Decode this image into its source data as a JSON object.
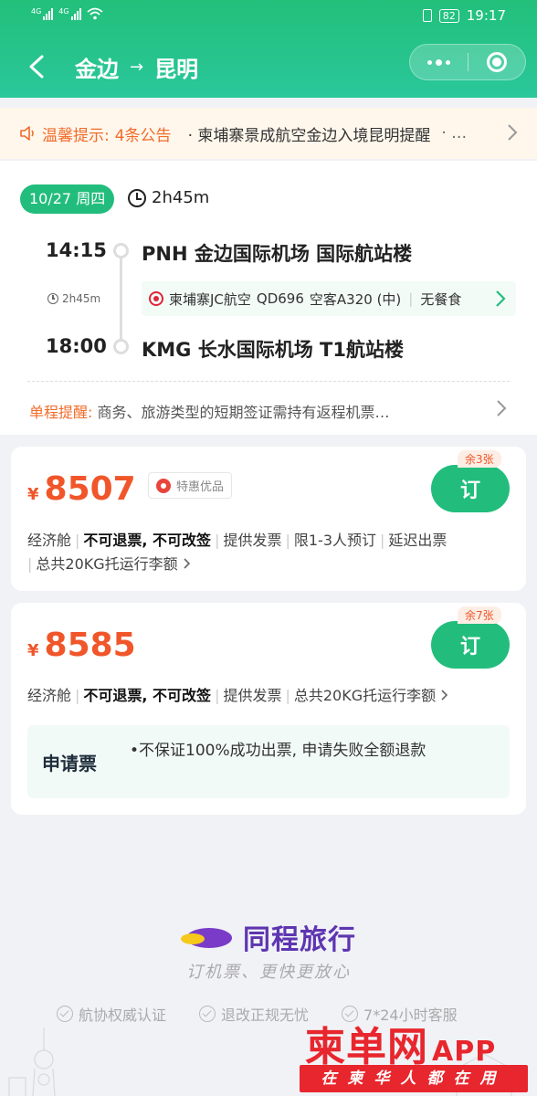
{
  "status_bar": {
    "net1": "4G",
    "net2": "4G",
    "battery": "82",
    "time": "19:17"
  },
  "nav": {
    "from": "金边",
    "arrow": "→",
    "to": "昆明"
  },
  "notice": {
    "label": "温馨提示:",
    "count": "4条公告",
    "text": "· 柬埔寨景成航空金边入境昆明提醒",
    "more": "· …"
  },
  "flight": {
    "date": "10/27 周四",
    "duration": "2h45m",
    "departure": {
      "time": "14:15",
      "airport": "PNH 金边国际机场 国际航站楼"
    },
    "arrival": {
      "time": "18:00",
      "airport": "KMG 长水国际机场 T1航站楼"
    },
    "segment_duration": "2h45m",
    "airline": "柬埔寨JC航空",
    "flight_no": "QD696",
    "aircraft": "空客A320 (中)",
    "meal": "无餐食",
    "oneway_label": "单程提醒:",
    "oneway_text": "商务、旅游类型的短期签证需持有返程机票…"
  },
  "offers": [
    {
      "currency": "¥",
      "price": "8507",
      "promo": "特惠优品",
      "remaining": "余3张",
      "book_label": "订",
      "tags_row1": [
        "经济舱",
        "不可退票, 不可改签",
        "提供发票",
        "限1-3人预订",
        "延迟出票"
      ],
      "tags_row2": [
        "总共20KG托运行李额"
      ]
    },
    {
      "currency": "¥",
      "price": "8585",
      "remaining": "余7张",
      "book_label": "订",
      "tags_row1": [
        "经济舱",
        "不可退票, 不可改签",
        "提供发票",
        "总共20KG托运行李额"
      ],
      "apply_label": "申请票",
      "apply_text": "•不保证100%成功出票, 申请失败全额退款"
    }
  ],
  "brand": {
    "name": "同程旅行",
    "slogan": "订机票、更快更放心",
    "certs": [
      "航协权威认证",
      "退改正规无忧",
      "7*24小时客服"
    ]
  },
  "watermark": {
    "main": "柬单网",
    "app": "APP",
    "sub": "在柬华人都在用"
  },
  "colors": {
    "primary": "#22bd7c",
    "price": "#f0562a",
    "notice": "#f26b2a",
    "brand": "#5e35b1",
    "watermark": "#e8262d"
  }
}
